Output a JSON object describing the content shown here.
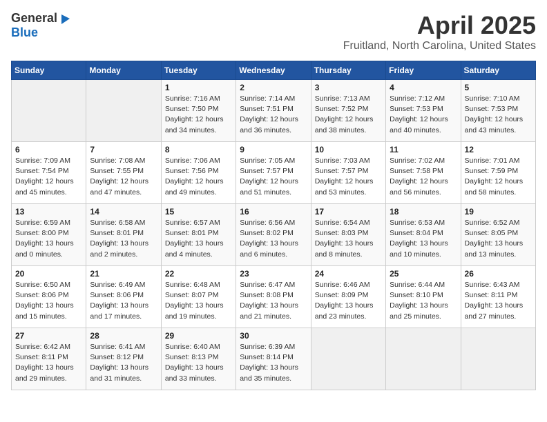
{
  "header": {
    "logo_general": "General",
    "logo_blue": "Blue",
    "title": "April 2025",
    "subtitle": "Fruitland, North Carolina, United States"
  },
  "weekdays": [
    "Sunday",
    "Monday",
    "Tuesday",
    "Wednesday",
    "Thursday",
    "Friday",
    "Saturday"
  ],
  "weeks": [
    [
      {
        "day": "",
        "info": ""
      },
      {
        "day": "",
        "info": ""
      },
      {
        "day": "1",
        "info": "Sunrise: 7:16 AM\nSunset: 7:50 PM\nDaylight: 12 hours\nand 34 minutes."
      },
      {
        "day": "2",
        "info": "Sunrise: 7:14 AM\nSunset: 7:51 PM\nDaylight: 12 hours\nand 36 minutes."
      },
      {
        "day": "3",
        "info": "Sunrise: 7:13 AM\nSunset: 7:52 PM\nDaylight: 12 hours\nand 38 minutes."
      },
      {
        "day": "4",
        "info": "Sunrise: 7:12 AM\nSunset: 7:53 PM\nDaylight: 12 hours\nand 40 minutes."
      },
      {
        "day": "5",
        "info": "Sunrise: 7:10 AM\nSunset: 7:53 PM\nDaylight: 12 hours\nand 43 minutes."
      }
    ],
    [
      {
        "day": "6",
        "info": "Sunrise: 7:09 AM\nSunset: 7:54 PM\nDaylight: 12 hours\nand 45 minutes."
      },
      {
        "day": "7",
        "info": "Sunrise: 7:08 AM\nSunset: 7:55 PM\nDaylight: 12 hours\nand 47 minutes."
      },
      {
        "day": "8",
        "info": "Sunrise: 7:06 AM\nSunset: 7:56 PM\nDaylight: 12 hours\nand 49 minutes."
      },
      {
        "day": "9",
        "info": "Sunrise: 7:05 AM\nSunset: 7:57 PM\nDaylight: 12 hours\nand 51 minutes."
      },
      {
        "day": "10",
        "info": "Sunrise: 7:03 AM\nSunset: 7:57 PM\nDaylight: 12 hours\nand 53 minutes."
      },
      {
        "day": "11",
        "info": "Sunrise: 7:02 AM\nSunset: 7:58 PM\nDaylight: 12 hours\nand 56 minutes."
      },
      {
        "day": "12",
        "info": "Sunrise: 7:01 AM\nSunset: 7:59 PM\nDaylight: 12 hours\nand 58 minutes."
      }
    ],
    [
      {
        "day": "13",
        "info": "Sunrise: 6:59 AM\nSunset: 8:00 PM\nDaylight: 13 hours\nand 0 minutes."
      },
      {
        "day": "14",
        "info": "Sunrise: 6:58 AM\nSunset: 8:01 PM\nDaylight: 13 hours\nand 2 minutes."
      },
      {
        "day": "15",
        "info": "Sunrise: 6:57 AM\nSunset: 8:01 PM\nDaylight: 13 hours\nand 4 minutes."
      },
      {
        "day": "16",
        "info": "Sunrise: 6:56 AM\nSunset: 8:02 PM\nDaylight: 13 hours\nand 6 minutes."
      },
      {
        "day": "17",
        "info": "Sunrise: 6:54 AM\nSunset: 8:03 PM\nDaylight: 13 hours\nand 8 minutes."
      },
      {
        "day": "18",
        "info": "Sunrise: 6:53 AM\nSunset: 8:04 PM\nDaylight: 13 hours\nand 10 minutes."
      },
      {
        "day": "19",
        "info": "Sunrise: 6:52 AM\nSunset: 8:05 PM\nDaylight: 13 hours\nand 13 minutes."
      }
    ],
    [
      {
        "day": "20",
        "info": "Sunrise: 6:50 AM\nSunset: 8:06 PM\nDaylight: 13 hours\nand 15 minutes."
      },
      {
        "day": "21",
        "info": "Sunrise: 6:49 AM\nSunset: 8:06 PM\nDaylight: 13 hours\nand 17 minutes."
      },
      {
        "day": "22",
        "info": "Sunrise: 6:48 AM\nSunset: 8:07 PM\nDaylight: 13 hours\nand 19 minutes."
      },
      {
        "day": "23",
        "info": "Sunrise: 6:47 AM\nSunset: 8:08 PM\nDaylight: 13 hours\nand 21 minutes."
      },
      {
        "day": "24",
        "info": "Sunrise: 6:46 AM\nSunset: 8:09 PM\nDaylight: 13 hours\nand 23 minutes."
      },
      {
        "day": "25",
        "info": "Sunrise: 6:44 AM\nSunset: 8:10 PM\nDaylight: 13 hours\nand 25 minutes."
      },
      {
        "day": "26",
        "info": "Sunrise: 6:43 AM\nSunset: 8:11 PM\nDaylight: 13 hours\nand 27 minutes."
      }
    ],
    [
      {
        "day": "27",
        "info": "Sunrise: 6:42 AM\nSunset: 8:11 PM\nDaylight: 13 hours\nand 29 minutes."
      },
      {
        "day": "28",
        "info": "Sunrise: 6:41 AM\nSunset: 8:12 PM\nDaylight: 13 hours\nand 31 minutes."
      },
      {
        "day": "29",
        "info": "Sunrise: 6:40 AM\nSunset: 8:13 PM\nDaylight: 13 hours\nand 33 minutes."
      },
      {
        "day": "30",
        "info": "Sunrise: 6:39 AM\nSunset: 8:14 PM\nDaylight: 13 hours\nand 35 minutes."
      },
      {
        "day": "",
        "info": ""
      },
      {
        "day": "",
        "info": ""
      },
      {
        "day": "",
        "info": ""
      }
    ]
  ]
}
